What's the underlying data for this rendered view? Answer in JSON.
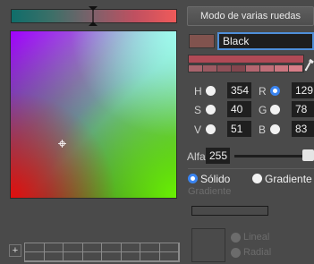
{
  "mode_button": {
    "label": "Modo de varias ruedas"
  },
  "color_name": {
    "value": "Black"
  },
  "hsb": [
    {
      "key": "h",
      "label": "H",
      "value": "354",
      "selected": false
    },
    {
      "key": "s",
      "label": "S",
      "value": "40",
      "selected": false
    },
    {
      "key": "v",
      "label": "V",
      "value": "51",
      "selected": false
    }
  ],
  "rgb": [
    {
      "key": "r",
      "label": "R",
      "value": "129",
      "selected": true
    },
    {
      "key": "g",
      "label": "G",
      "value": "78",
      "selected": false
    },
    {
      "key": "b",
      "label": "B",
      "value": "83",
      "selected": false
    }
  ],
  "alpha": {
    "label": "Alfa",
    "value": "255",
    "level": 1.0
  },
  "fill_type": {
    "solid_label": "Sólido",
    "gradient_label": "Gradiente",
    "selected": "solid"
  },
  "gradient": {
    "section_label": "Gradiente",
    "linear_label": "Lineal",
    "radial_label": "Radial"
  },
  "swatch_grid": {
    "add_label": "+"
  },
  "colors": {
    "current": "#81534e",
    "accent": "#3a84f0",
    "shades": [
      "#a8646c",
      "#9c5a62",
      "#8f5058",
      "#83464e",
      "#b46670",
      "#c06e78",
      "#cc7680",
      "#d87e88"
    ]
  }
}
